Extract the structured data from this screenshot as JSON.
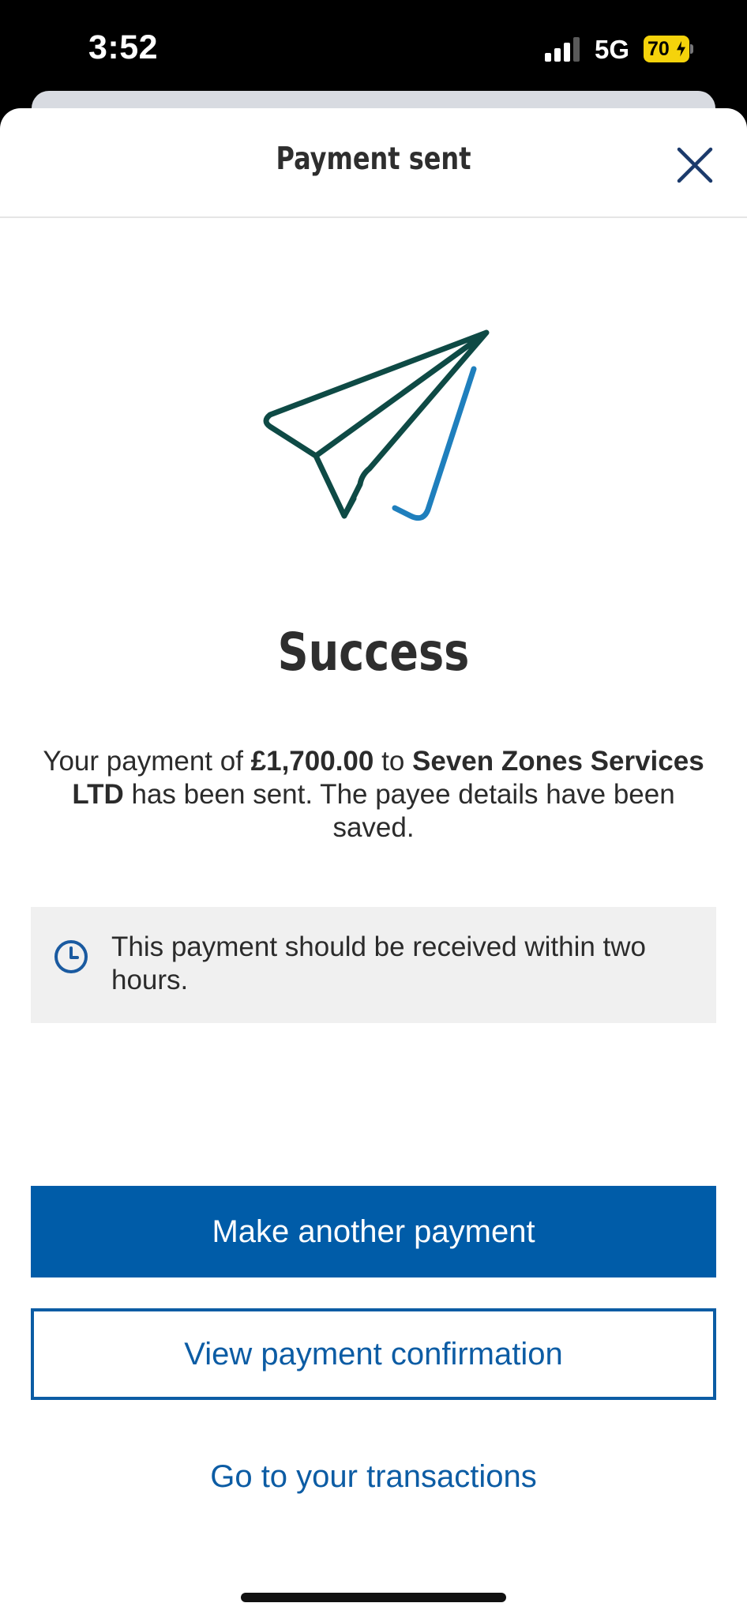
{
  "status_bar": {
    "time": "3:52",
    "network": "5G",
    "battery": "70"
  },
  "header": {
    "title": "Payment sent"
  },
  "main": {
    "illustration": "paper-plane-icon",
    "heading": "Success",
    "message": {
      "prefix": "Your payment of ",
      "amount": "£1,700.00",
      "middle": " to ",
      "payee": "Seven Zones Services LTD",
      "suffix": " has been sent. The payee details have been saved."
    },
    "info": {
      "icon": "clock-icon",
      "text": "This payment should be received within two hours."
    }
  },
  "actions": {
    "primary_label": "Make another payment",
    "secondary_label": "View payment confirmation",
    "link_label": "Go to your transactions"
  },
  "colors": {
    "primary": "#005ca8",
    "link": "#0c5ca4",
    "plane_dark": "#0e4a45",
    "plane_accent": "#1f7fbd",
    "battery": "#f5d30b"
  }
}
